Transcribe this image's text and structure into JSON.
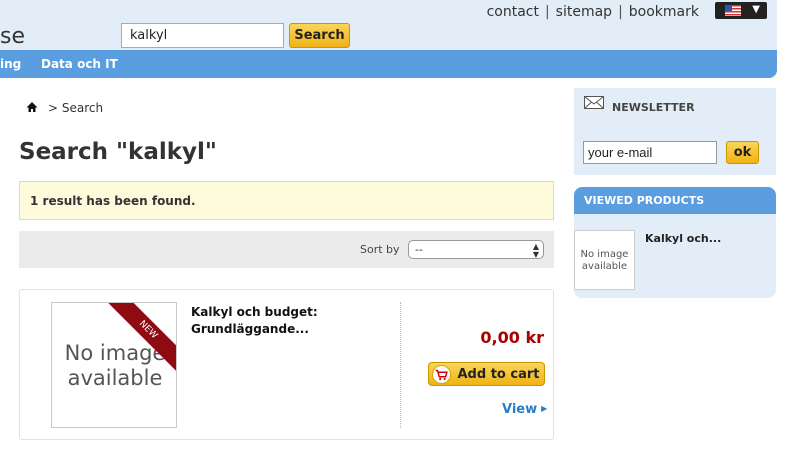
{
  "header": {
    "logo_text": "se",
    "search_value": "kalkyl",
    "search_button": "Search",
    "links": [
      "contact",
      "sitemap",
      "bookmark"
    ]
  },
  "nav": {
    "items": [
      "ing",
      "Data och IT"
    ]
  },
  "breadcrumb": {
    "current": "Search"
  },
  "page_title": "Search \"kalkyl\"",
  "result_message": "1 result has been found.",
  "sort": {
    "label": "Sort by",
    "selected": "--"
  },
  "product": {
    "image_placeholder": "No image available",
    "badge": "NEW",
    "name": "Kalkyl och budget: Grundläggande...",
    "price": "0,00 kr",
    "add_to_cart": "Add to cart",
    "view_link": "View"
  },
  "newsletter": {
    "title": "NEWSLETTER",
    "email_value": "your e-mail",
    "ok_button": "ok"
  },
  "viewed_products": {
    "title": "VIEWED PRODUCTS",
    "image_placeholder": "No image available",
    "item_name": "Kalkyl och..."
  }
}
